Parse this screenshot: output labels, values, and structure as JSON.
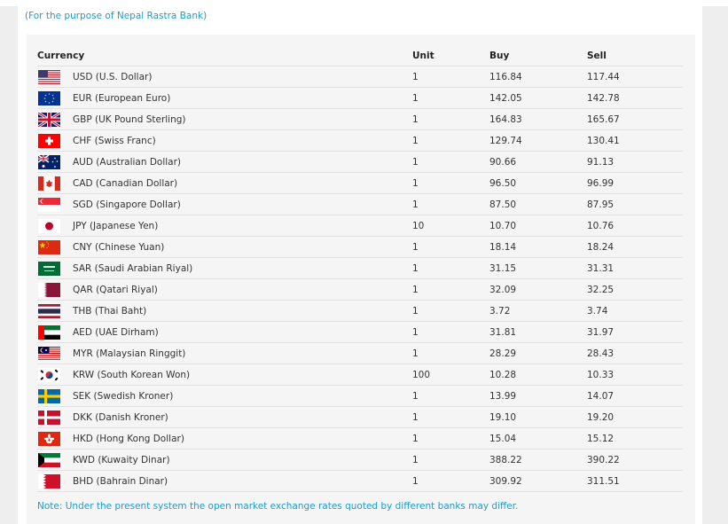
{
  "header": {
    "purpose_text": "(For the purpose of Nepal Rastra Bank)"
  },
  "table": {
    "headers": {
      "currency": "Currency",
      "unit": "Unit",
      "buy": "Buy",
      "sell": "Sell"
    },
    "rows": [
      {
        "flag": "us-flag-icon",
        "currency": "USD (U.S. Dollar)",
        "unit": "1",
        "buy": "116.84",
        "sell": "117.44"
      },
      {
        "flag": "eu-flag-icon",
        "currency": "EUR (European Euro)",
        "unit": "1",
        "buy": "142.05",
        "sell": "142.78"
      },
      {
        "flag": "gb-flag-icon",
        "currency": "GBP (UK Pound Sterling)",
        "unit": "1",
        "buy": "164.83",
        "sell": "165.67"
      },
      {
        "flag": "ch-flag-icon",
        "currency": "CHF (Swiss Franc)",
        "unit": "1",
        "buy": "129.74",
        "sell": "130.41"
      },
      {
        "flag": "au-flag-icon",
        "currency": "AUD (Australian Dollar)",
        "unit": "1",
        "buy": "90.66",
        "sell": "91.13"
      },
      {
        "flag": "ca-flag-icon",
        "currency": "CAD (Canadian Dollar)",
        "unit": "1",
        "buy": "96.50",
        "sell": "96.99"
      },
      {
        "flag": "sg-flag-icon",
        "currency": "SGD (Singapore Dollar)",
        "unit": "1",
        "buy": "87.50",
        "sell": "87.95"
      },
      {
        "flag": "jp-flag-icon",
        "currency": "JPY (Japanese Yen)",
        "unit": "10",
        "buy": "10.70",
        "sell": "10.76"
      },
      {
        "flag": "cn-flag-icon",
        "currency": "CNY (Chinese Yuan)",
        "unit": "1",
        "buy": "18.14",
        "sell": "18.24"
      },
      {
        "flag": "sa-flag-icon",
        "currency": "SAR (Saudi Arabian Riyal)",
        "unit": "1",
        "buy": "31.15",
        "sell": "31.31"
      },
      {
        "flag": "qa-flag-icon",
        "currency": "QAR (Qatari Riyal)",
        "unit": "1",
        "buy": "32.09",
        "sell": "32.25"
      },
      {
        "flag": "th-flag-icon",
        "currency": "THB (Thai Baht)",
        "unit": "1",
        "buy": "3.72",
        "sell": "3.74"
      },
      {
        "flag": "ae-flag-icon",
        "currency": "AED (UAE Dirham)",
        "unit": "1",
        "buy": "31.81",
        "sell": "31.97"
      },
      {
        "flag": "my-flag-icon",
        "currency": "MYR (Malaysian Ringgit)",
        "unit": "1",
        "buy": "28.29",
        "sell": "28.43"
      },
      {
        "flag": "kr-flag-icon",
        "currency": "KRW (South Korean Won)",
        "unit": "100",
        "buy": "10.28",
        "sell": "10.33"
      },
      {
        "flag": "se-flag-icon",
        "currency": "SEK (Swedish Kroner)",
        "unit": "1",
        "buy": "13.99",
        "sell": "14.07"
      },
      {
        "flag": "dk-flag-icon",
        "currency": "DKK (Danish Kroner)",
        "unit": "1",
        "buy": "19.10",
        "sell": "19.20"
      },
      {
        "flag": "hk-flag-icon",
        "currency": "HKD (Hong Kong Dollar)",
        "unit": "1",
        "buy": "15.04",
        "sell": "15.12"
      },
      {
        "flag": "kw-flag-icon",
        "currency": "KWD (Kuwaity Dinar)",
        "unit": "1",
        "buy": "388.22",
        "sell": "390.22"
      },
      {
        "flag": "bh-flag-icon",
        "currency": "BHD (Bahrain Dinar)",
        "unit": "1",
        "buy": "309.92",
        "sell": "311.51"
      }
    ]
  },
  "footer": {
    "note": "Note: Under the present system the open market exchange rates quoted by different banks may differ."
  },
  "colors": {
    "accent": "#1e9cc9",
    "panel_bg": "#f5f5f5",
    "page_bg": "#eeeeee"
  }
}
